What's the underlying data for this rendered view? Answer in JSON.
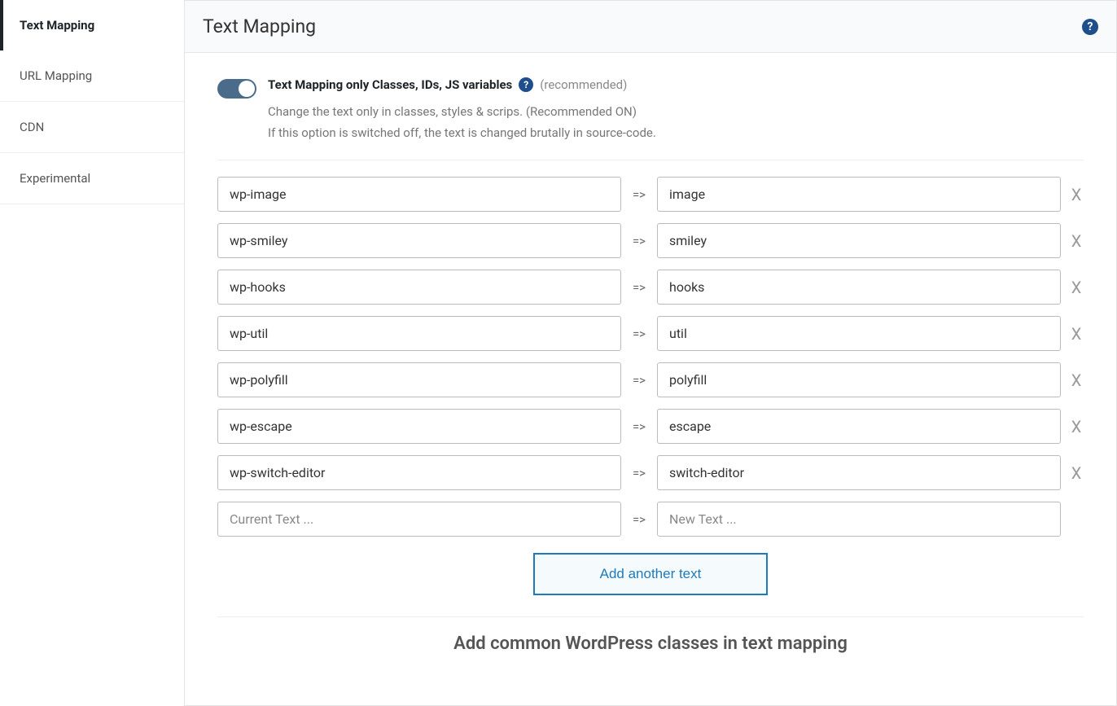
{
  "sidebar": {
    "items": [
      {
        "label": "Text Mapping",
        "active": true
      },
      {
        "label": "URL Mapping",
        "active": false
      },
      {
        "label": "CDN",
        "active": false
      },
      {
        "label": "Experimental",
        "active": false
      }
    ]
  },
  "header": {
    "title": "Text Mapping"
  },
  "setting": {
    "label": "Text Mapping only Classes, IDs, JS variables",
    "recommended": "(recommended)",
    "desc_line1": "Change the text only in classes, styles & scrips. (Recommended ON)",
    "desc_line2": "If this option is switched off, the text is changed brutally in source-code.",
    "enabled": true
  },
  "mappings": [
    {
      "from": "wp-image",
      "to": "image"
    },
    {
      "from": "wp-smiley",
      "to": "smiley"
    },
    {
      "from": "wp-hooks",
      "to": "hooks"
    },
    {
      "from": "wp-util",
      "to": "util"
    },
    {
      "from": "wp-polyfill",
      "to": "polyfill"
    },
    {
      "from": "wp-escape",
      "to": "escape"
    },
    {
      "from": "wp-switch-editor",
      "to": "switch-editor"
    }
  ],
  "empty_row": {
    "from_placeholder": "Current Text ...",
    "to_placeholder": "New Text ..."
  },
  "arrow": "=>",
  "remove_label": "X",
  "add_button": "Add another text",
  "footer_heading": "Add common WordPress classes in text mapping",
  "help_glyph": "?"
}
